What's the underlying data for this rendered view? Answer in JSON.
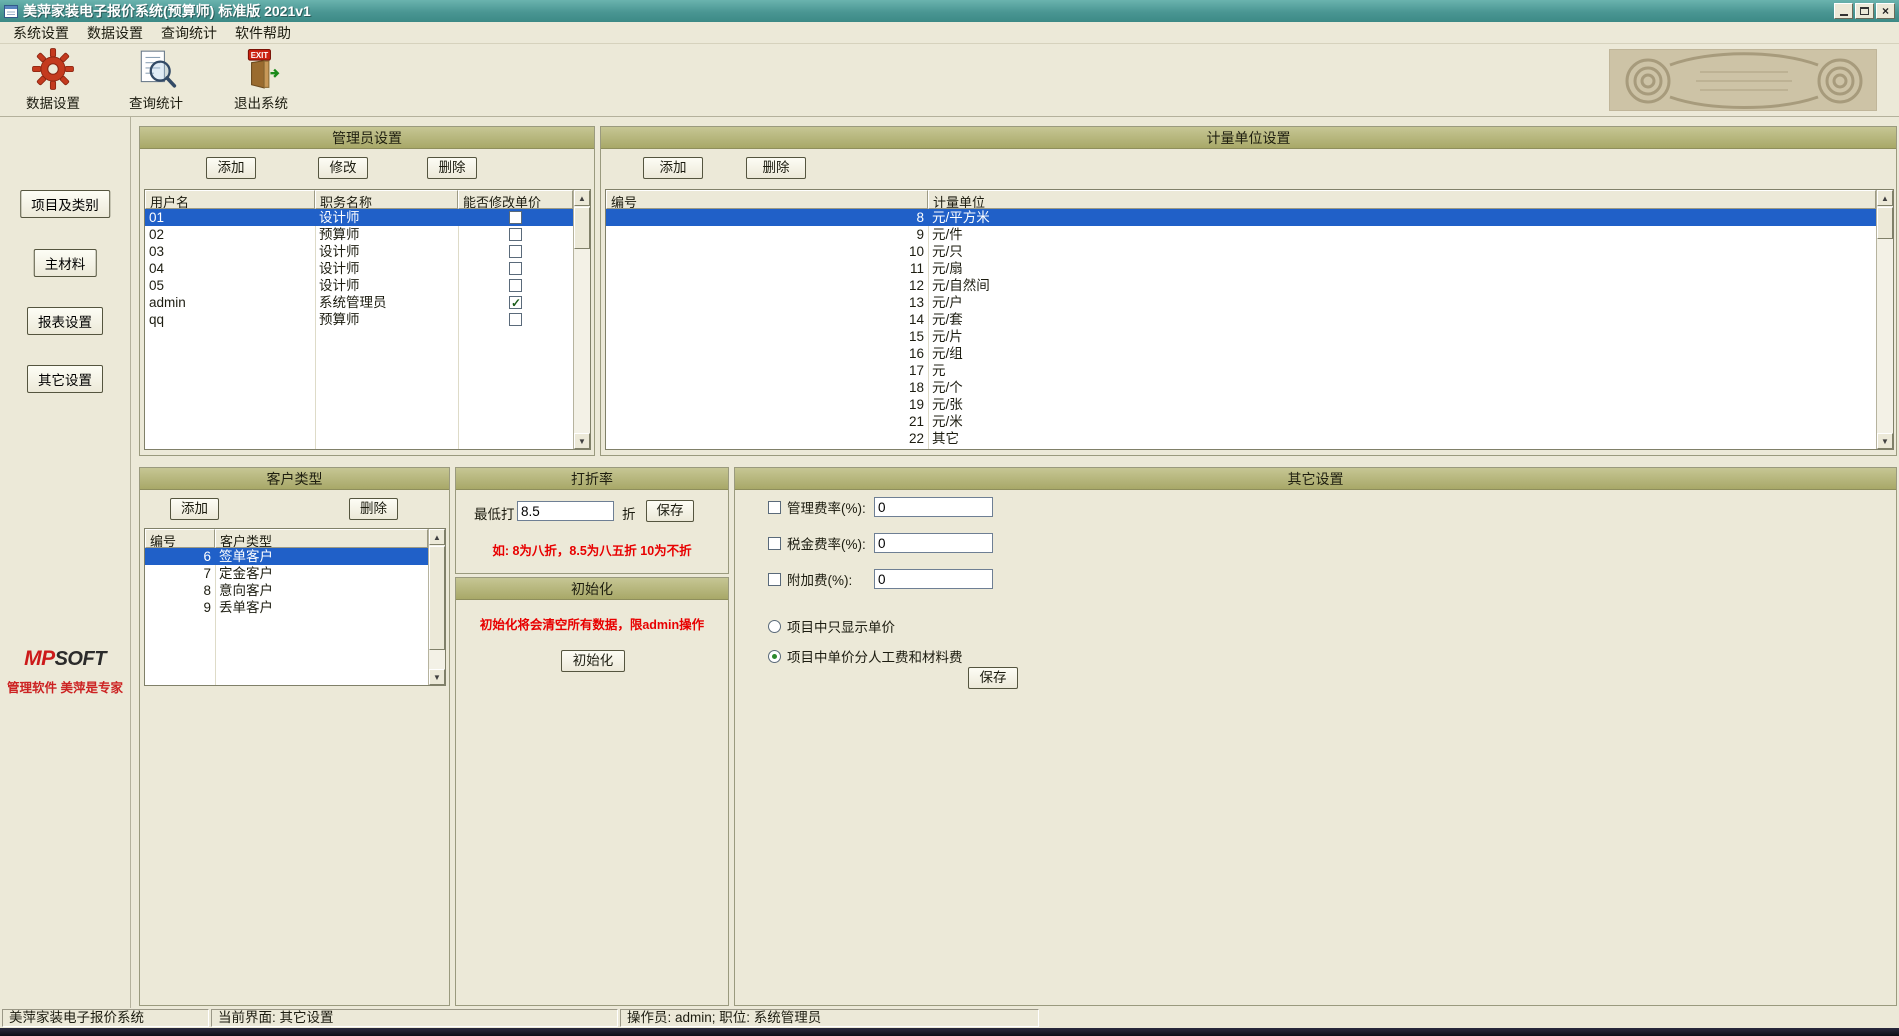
{
  "window": {
    "title": "美萍家装电子报价系统(预算师) 标准版  2021v1"
  },
  "colors": {
    "titlebar": "#4a9693",
    "panel_header": "#b2b276",
    "selection": "#2060c8",
    "accent_red": "#e80000",
    "background": "#ECE9D8"
  },
  "menu": {
    "items": [
      "系统设置",
      "数据设置",
      "查询统计",
      "软件帮助"
    ]
  },
  "toolbar": {
    "exit_badge": "EXIT",
    "items": [
      {
        "label": "数据设置"
      },
      {
        "label": "查询统计"
      },
      {
        "label": "退出系统"
      }
    ]
  },
  "sidebar": {
    "buttons": [
      "项目及类别",
      "主材料",
      "报表设置",
      "其它设置"
    ],
    "logo_mp": "MP",
    "logo_soft": "SOFT",
    "slogan": "管理软件 美萍是专家"
  },
  "admin_panel": {
    "title": "管理员设置",
    "buttons": [
      "添加",
      "修改",
      "删除"
    ],
    "columns": [
      "用户名",
      "职务名称",
      "能否修改单价"
    ],
    "rows": [
      {
        "username": "01",
        "role": "设计师",
        "checked": false,
        "selected": true
      },
      {
        "username": "02",
        "role": "预算师",
        "checked": false
      },
      {
        "username": "03",
        "role": "设计师",
        "checked": false
      },
      {
        "username": "04",
        "role": "设计师",
        "checked": false
      },
      {
        "username": "05",
        "role": "设计师",
        "checked": false
      },
      {
        "username": "admin",
        "role": "系统管理员",
        "checked": true
      },
      {
        "username": "qq",
        "role": "预算师",
        "checked": false
      }
    ]
  },
  "unit_panel": {
    "title": "计量单位设置",
    "buttons": [
      "添加",
      "删除"
    ],
    "columns": [
      "编号",
      "计量单位"
    ],
    "rows": [
      {
        "id": "8",
        "unit": "元/平方米",
        "selected": true
      },
      {
        "id": "9",
        "unit": "元/件"
      },
      {
        "id": "10",
        "unit": "元/只"
      },
      {
        "id": "11",
        "unit": "元/扇"
      },
      {
        "id": "12",
        "unit": "元/自然间"
      },
      {
        "id": "13",
        "unit": "元/户"
      },
      {
        "id": "14",
        "unit": "元/套"
      },
      {
        "id": "15",
        "unit": "元/片"
      },
      {
        "id": "16",
        "unit": "元/组"
      },
      {
        "id": "17",
        "unit": "元"
      },
      {
        "id": "18",
        "unit": "元/个"
      },
      {
        "id": "19",
        "unit": "元/张"
      },
      {
        "id": "21",
        "unit": "元/米"
      },
      {
        "id": "22",
        "unit": "其它"
      }
    ]
  },
  "customer_panel": {
    "title": "客户类型",
    "buttons": [
      "添加",
      "删除"
    ],
    "columns": [
      "编号",
      "客户类型"
    ],
    "rows": [
      {
        "id": "6",
        "type": "签单客户",
        "selected": true
      },
      {
        "id": "7",
        "type": "定金客户"
      },
      {
        "id": "8",
        "type": "意向客户"
      },
      {
        "id": "9",
        "type": "丢单客户"
      }
    ]
  },
  "discount_panel": {
    "title": "打折率",
    "label": "最低打",
    "value": "8.5",
    "unit_label": "折",
    "save_label": "保存",
    "hint": "如: 8为八折，8.5为八五折  10为不折"
  },
  "init_panel": {
    "title": "初始化",
    "warning": "初始化将会清空所有数据，限admin操作",
    "button_label": "初始化"
  },
  "other_panel": {
    "title": "其它设置",
    "fields": [
      {
        "label": "管理费率(%):",
        "value": "0",
        "checked": false
      },
      {
        "label": "税金费率(%):",
        "value": "0",
        "checked": false
      },
      {
        "label": "附加费(%):",
        "value": "0",
        "checked": false
      }
    ],
    "radios": [
      {
        "label": "项目中只显示单价",
        "selected": false
      },
      {
        "label": "项目中单价分人工费和材料费",
        "selected": true
      }
    ],
    "save_label": "保存"
  },
  "statusbar": {
    "app": "美萍家装电子报价系统",
    "screen": "当前界面: 其它设置",
    "operator": "操作员: admin; 职位: 系统管理员"
  }
}
